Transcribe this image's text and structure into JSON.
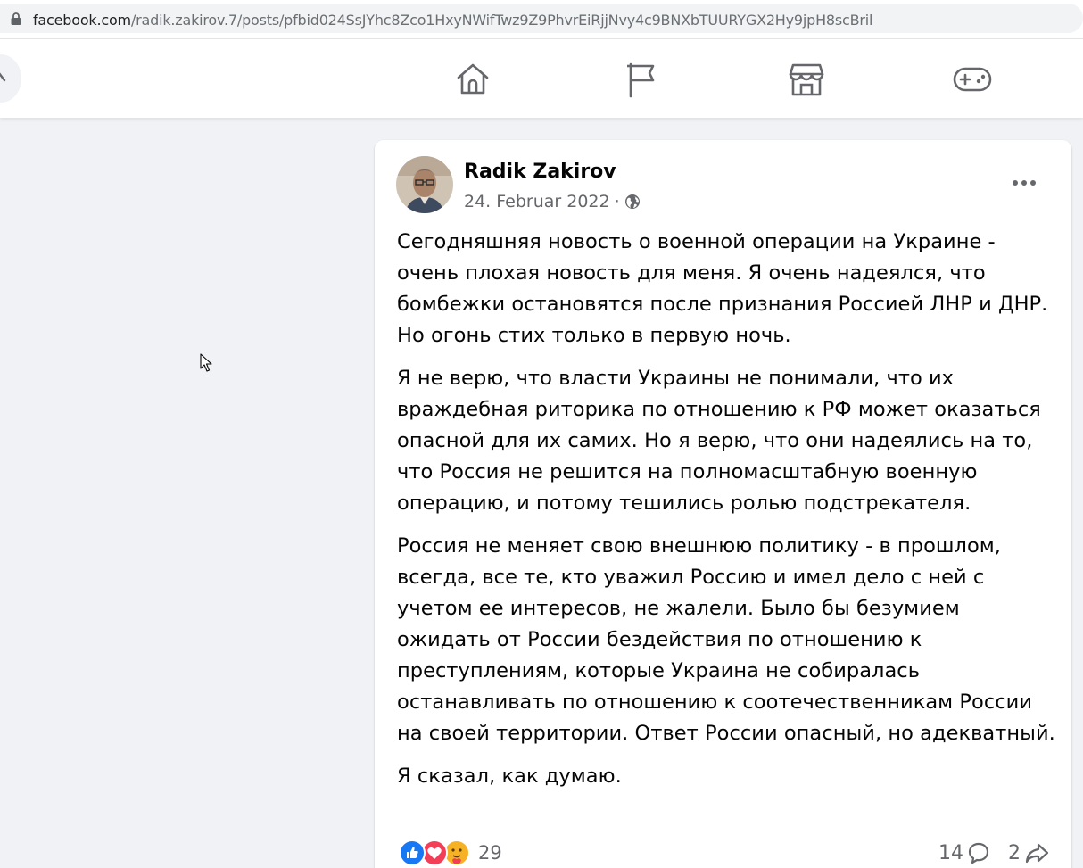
{
  "browser": {
    "url_host": "facebook.com",
    "url_path": "/radik.zakirov.7/posts/pfbid024SsJYhc8Zco1HxyNWifTwz9Z9PhvrEiRjjNvy4c9BNXbTUURYGX2Hy9jpH8scBril"
  },
  "nav": {
    "items": [
      {
        "icon": "home-icon"
      },
      {
        "icon": "flag-icon"
      },
      {
        "icon": "marketplace-icon"
      },
      {
        "icon": "gaming-icon"
      }
    ]
  },
  "post": {
    "author": "Radik Zakirov",
    "date": "24. Februar 2022",
    "separator": "·",
    "audience_icon": "globe-icon",
    "paragraphs": [
      "Сегодняшняя новость о военной операции на Украине - очень плохая новость для меня.  Я очень надеялся, что бомбежки остановятся после признания Россией ЛНР и ДНР.  Но огонь стих только в первую ночь.",
      "Я не верю, что власти Украины не понимали, что их враждебная риторика по отношению к РФ может оказаться опасной для их самих.  Но я верю, что они надеялись на то, что Россия не решится на полномасштабную военную операцию, и потому тешились ролью подстрекателя.",
      "Россия не меняет свою внешнюю политику - в прошлом, всегда, все те, кто уважил Россию и имел дело с ней с учетом ее интересов, не жалели.  Было бы безумием ожидать от России бездействия по отношению к преступлениям, которые Украина не собиралась останавливать по отношению к соотечественникам России на своей территории.  Ответ России опасный, но адекватный.",
      "Я сказал, как думаю."
    ],
    "reactions": {
      "icons": [
        "like-icon",
        "love-icon",
        "care-icon"
      ],
      "count": "29"
    },
    "comments_count": "14",
    "shares_count": "2"
  },
  "colors": {
    "page_bg": "#f0f2f5",
    "like_blue": "#1877f2",
    "love_red": "#f33e58",
    "care_yellow": "#f7b125",
    "secondary_text": "#65676b"
  }
}
